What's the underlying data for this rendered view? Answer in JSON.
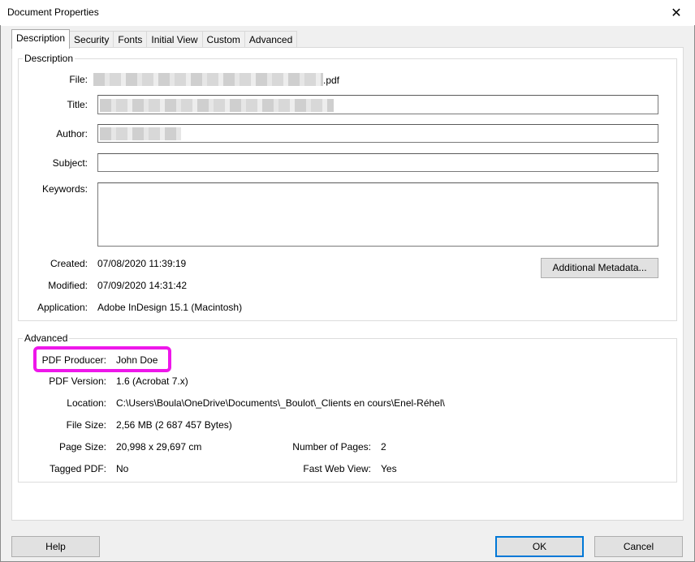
{
  "window": {
    "title": "Document Properties"
  },
  "tabs": [
    {
      "label": "Description"
    },
    {
      "label": "Security"
    },
    {
      "label": "Fonts"
    },
    {
      "label": "Initial View"
    },
    {
      "label": "Custom"
    },
    {
      "label": "Advanced"
    }
  ],
  "description": {
    "group_label": "Description",
    "file_label": "File:",
    "file_suffix": ".pdf",
    "title_label": "Title:",
    "author_label": "Author:",
    "subject_label": "Subject:",
    "subject_value": "",
    "keywords_label": "Keywords:",
    "keywords_value": "",
    "created_label": "Created:",
    "created_value": "07/08/2020 11:39:19",
    "modified_label": "Modified:",
    "modified_value": "07/09/2020 14:31:42",
    "application_label": "Application:",
    "application_value": "Adobe InDesign 15.1 (Macintosh)",
    "metadata_button": "Additional Metadata..."
  },
  "advanced": {
    "group_label": "Advanced",
    "producer_label": "PDF Producer:",
    "producer_value": "John Doe",
    "version_label": "PDF Version:",
    "version_value": "1.6 (Acrobat 7.x)",
    "location_label": "Location:",
    "location_value": "C:\\Users\\Boula\\OneDrive\\Documents\\_Boulot\\_Clients en cours\\Enel-Réhel\\",
    "filesize_label": "File Size:",
    "filesize_value": "2,56 MB (2 687 457 Bytes)",
    "pagesize_label": "Page Size:",
    "pagesize_value": "20,998 x 29,697 cm",
    "pages_label": "Number of Pages:",
    "pages_value": "2",
    "tagged_label": "Tagged PDF:",
    "tagged_value": "No",
    "fastweb_label": "Fast Web View:",
    "fastweb_value": "Yes"
  },
  "buttons": {
    "help": "Help",
    "ok": "OK",
    "cancel": "Cancel"
  },
  "colors": {
    "highlight": "#ee17ea",
    "ok_border": "#0078d7"
  },
  "icons": {
    "close": "close-icon"
  }
}
